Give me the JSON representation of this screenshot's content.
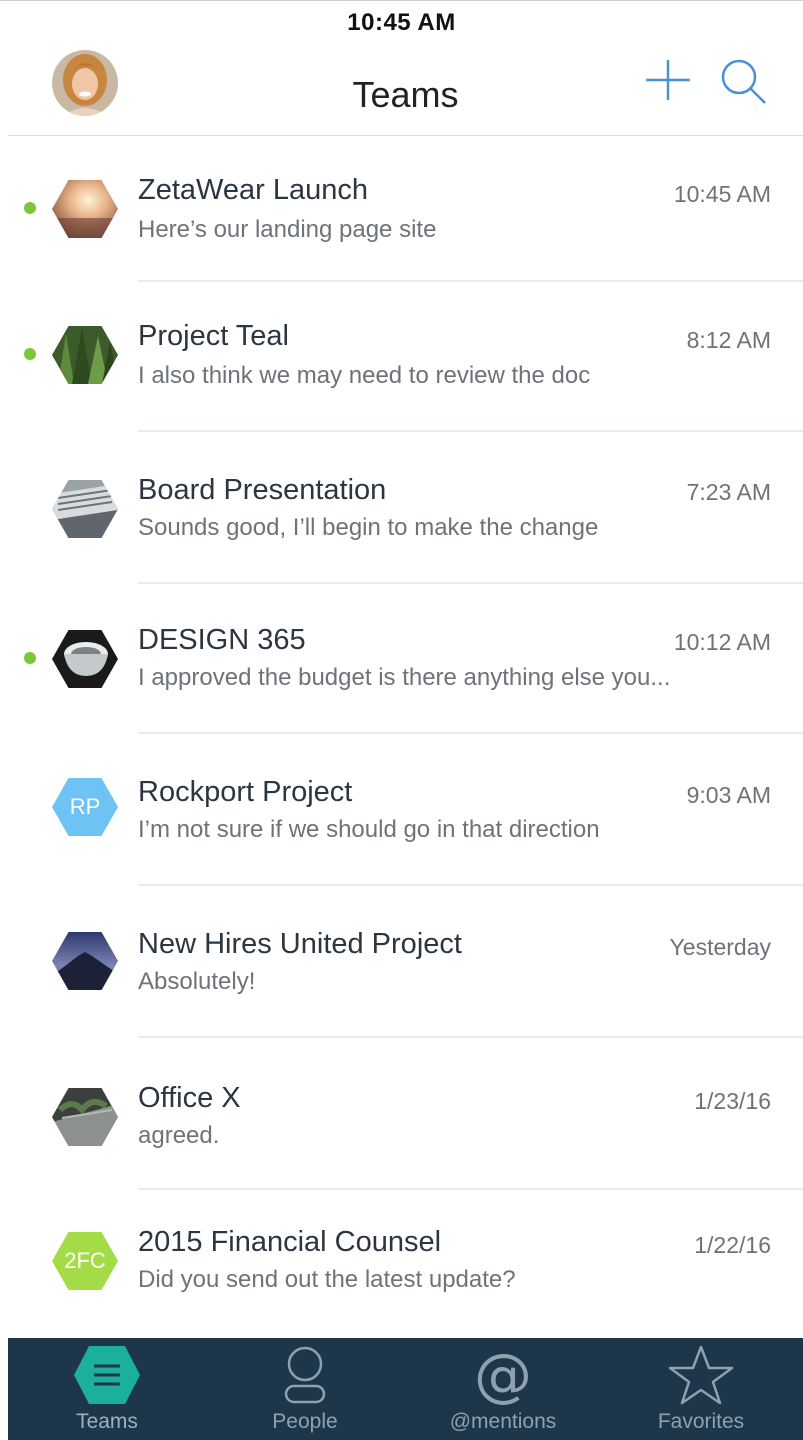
{
  "status_bar": {
    "time": "10:45 AM"
  },
  "header": {
    "title": "Teams",
    "add_icon": "plus-icon",
    "search_icon": "search-icon"
  },
  "colors": {
    "accent": "#4a90d9",
    "online": "#7cc63a",
    "tabbar": "#1e3649",
    "active_tab": "#1bb09a"
  },
  "teams": [
    {
      "name": "ZetaWear Launch",
      "time": "10:45 AM",
      "preview": "Here’s our landing page site",
      "online": true,
      "avatar": "photo-sunlight"
    },
    {
      "name": "Project Teal",
      "time": "8:12 AM",
      "preview": "I also think we may need to review the doc",
      "online": true,
      "avatar": "photo-forest"
    },
    {
      "name": "Board Presentation",
      "time": "7:23 AM",
      "preview": "Sounds good, I’ll begin to make the change",
      "online": false,
      "avatar": "photo-laptop"
    },
    {
      "name": "DESIGN 365",
      "time": "10:12 AM",
      "preview": "I approved the budget is there anything else you...",
      "online": true,
      "avatar": "photo-coffee-cup"
    },
    {
      "name": "Rockport Project",
      "time": "9:03 AM",
      "preview": "I’m not sure if we should go in that direction",
      "online": false,
      "avatar_initials": "RP",
      "avatar_color": "#6ec3f4"
    },
    {
      "name": "New Hires United Project",
      "time": "Yesterday",
      "preview": "Absolutely!",
      "online": false,
      "avatar": "photo-mountain"
    },
    {
      "name": "Office X",
      "time": "1/23/16",
      "preview": "agreed.",
      "online": false,
      "avatar": "photo-plants"
    },
    {
      "name": "2015 Financial Counsel",
      "time": "1/22/16",
      "preview": "Did you send out the latest update?",
      "online": false,
      "avatar_initials": "2FC",
      "avatar_color": "#a4dc48"
    }
  ],
  "tabbar": {
    "tabs": [
      {
        "label": "Teams",
        "icon": "menu-hex-icon",
        "active": true
      },
      {
        "label": "People",
        "icon": "person-icon",
        "active": false
      },
      {
        "label": "@mentions",
        "icon": "at-icon",
        "active": false
      },
      {
        "label": "Favorites",
        "icon": "star-icon",
        "active": false
      }
    ]
  }
}
